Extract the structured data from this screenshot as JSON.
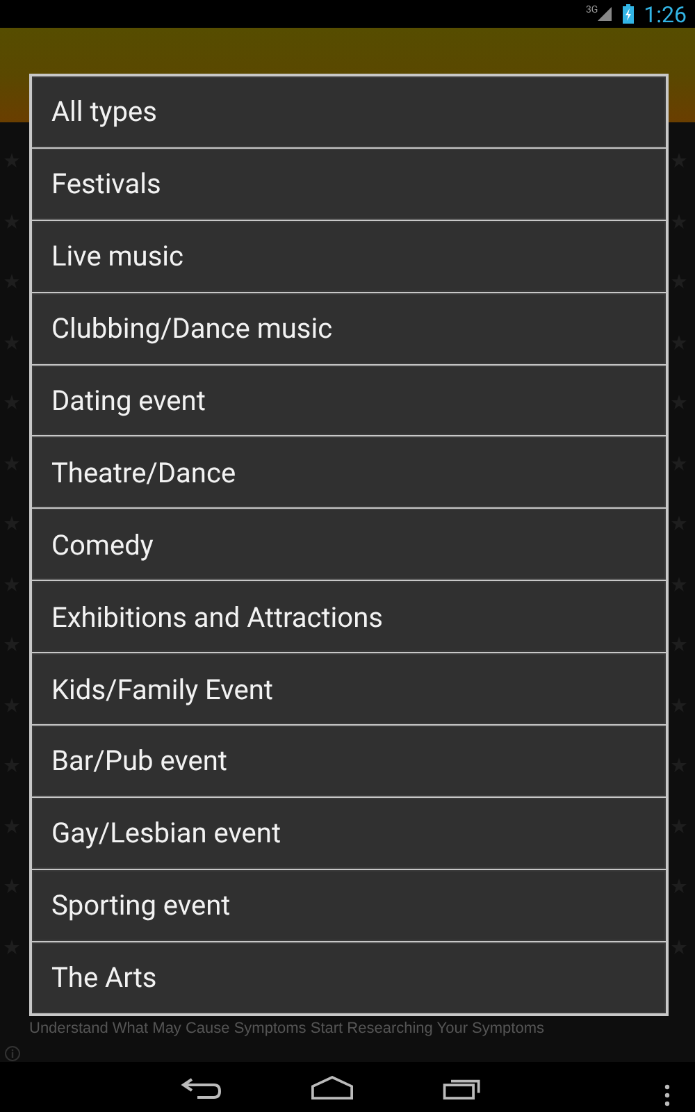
{
  "status_bar": {
    "network": "3G",
    "time": "1:26"
  },
  "dialog": {
    "items": [
      {
        "label": "All types"
      },
      {
        "label": "Festivals"
      },
      {
        "label": "Live music"
      },
      {
        "label": "Clubbing/Dance music"
      },
      {
        "label": "Dating event"
      },
      {
        "label": "Theatre/Dance"
      },
      {
        "label": "Comedy"
      },
      {
        "label": "Exhibitions and Attractions"
      },
      {
        "label": "Kids/Family Event"
      },
      {
        "label": "Bar/Pub event"
      },
      {
        "label": "Gay/Lesbian event"
      },
      {
        "label": "Sporting event"
      },
      {
        "label": "The Arts"
      }
    ]
  },
  "ad": {
    "text": "Understand What May Cause Symptoms Start Researching Your Symptoms"
  }
}
